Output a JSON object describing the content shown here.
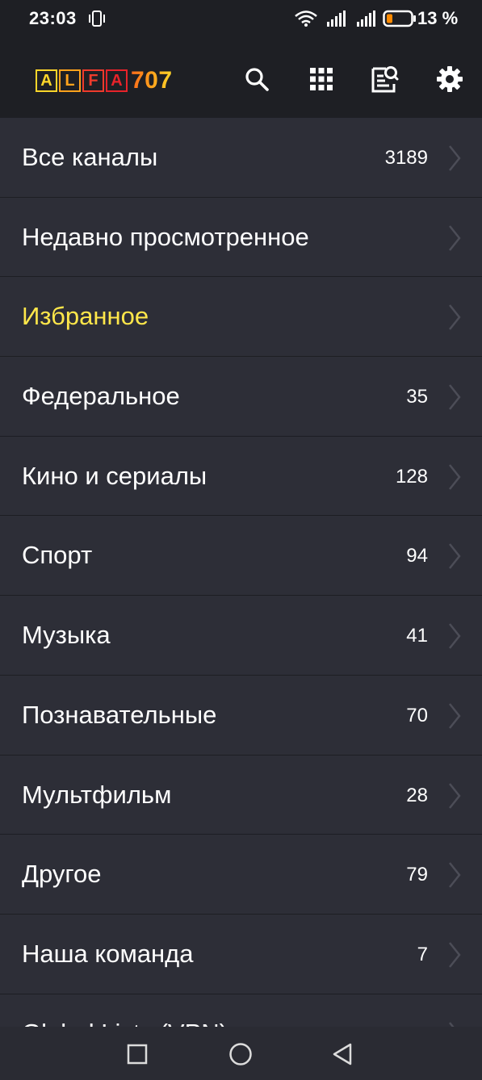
{
  "status_bar": {
    "time": "23:03",
    "battery_percent": "13 %",
    "icons": [
      "vibrate-icon",
      "wifi-icon",
      "signal-icon",
      "signal-icon",
      "battery-icon"
    ]
  },
  "header": {
    "logo": {
      "letters": [
        "A",
        "L",
        "F",
        "A"
      ],
      "number": "707"
    },
    "icons": [
      "search-icon",
      "grid-icon",
      "epg-icon",
      "gear-icon"
    ]
  },
  "colors": {
    "background": "#2d2e37",
    "header_bg": "#1e1f24",
    "highlight": "#ffe74a",
    "logo_gradient": [
      "#ffd62a",
      "#ff8c1a",
      "#e8232a",
      "#ff7a1a"
    ]
  },
  "categories": [
    {
      "label": "Все каналы",
      "count": "3189"
    },
    {
      "label": "Недавно просмотренное",
      "count": ""
    },
    {
      "label": "Избранное",
      "count": ""
    },
    {
      "label": "Федеральное",
      "count": "35"
    },
    {
      "label": "Кино и сериалы",
      "count": "128"
    },
    {
      "label": "Спорт",
      "count": "94"
    },
    {
      "label": "Музыка",
      "count": "41"
    },
    {
      "label": "Познавательные",
      "count": "70"
    },
    {
      "label": "Мультфильм",
      "count": "28"
    },
    {
      "label": "Другое",
      "count": "79"
    },
    {
      "label": "Наша команда",
      "count": "7"
    },
    {
      "label": "Global Lists (VPN)",
      "count": ""
    }
  ],
  "nav_bar": {
    "icons": [
      "recents-square-icon",
      "home-circle-icon",
      "back-triangle-icon"
    ]
  }
}
